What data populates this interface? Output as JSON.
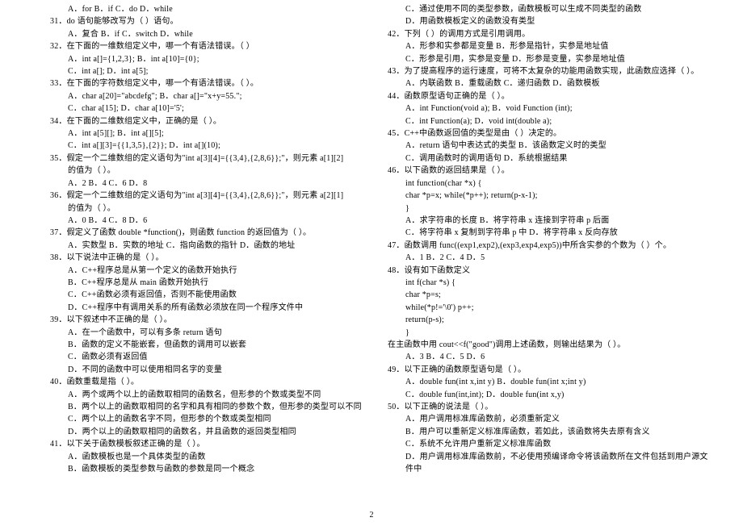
{
  "pageNumber": "2",
  "left": [
    {
      "cls": "indent1",
      "t": "A．for     B．if     C．do     D．while"
    },
    {
      "cls": "",
      "t": "31．do 语句能够改写为（     ）语句。"
    },
    {
      "cls": "indent1",
      "t": "A．复合     B．if     C．switch     D．while"
    },
    {
      "cls": "",
      "t": "32．在下面的一维数组定义中，哪一个有语法错误。（     ）"
    },
    {
      "cls": "indent1",
      "t": "A．int a[]={1,2,3};        B．int a[10]={0};"
    },
    {
      "cls": "indent1",
      "t": "C．int a[];               D．int a[5];"
    },
    {
      "cls": "",
      "t": "33．在下面的字符数组定义中，哪一个有语法错误。（     ）。"
    },
    {
      "cls": "indent1",
      "t": "A．char a[20]=\"abcdefg\";     B．char a[]=\"x+y=55.\";"
    },
    {
      "cls": "indent1",
      "t": "C．char a[15];              D．char a[10]='5';"
    },
    {
      "cls": "",
      "t": "34．在下面的二维数组定义中，正确的是（     ）。"
    },
    {
      "cls": "indent1",
      "t": "A．int a[5][];              B．int a[][5];"
    },
    {
      "cls": "indent1",
      "t": "C．int a[][3]={{1,3,5},{2}};  D．int a[](10);"
    },
    {
      "cls": "",
      "t": "35．假定一个二维数组的定义语句为\"int a[3][4]={{3,4},{2,8,6}};\"，则元素 a[1][2]"
    },
    {
      "cls": "indent1",
      "t": "的值为（     ）。"
    },
    {
      "cls": "indent1",
      "t": "A．2     B．4     C．6     D．8"
    },
    {
      "cls": "",
      "t": "36．假定一个二维数组的定义语句为\"int a[3][4]={{3,4},{2,8,6}};\"，则元素 a[2][1]"
    },
    {
      "cls": "indent1",
      "t": "的值为（     ）。"
    },
    {
      "cls": "indent1",
      "t": "A．0     B．4     C．8     D．6"
    },
    {
      "cls": "",
      "t": "37．假定义了函数 double *function()，则函数 function 的返回值为（     ）。"
    },
    {
      "cls": "indent1",
      "t": "A．实数型     B．实数的地址     C．指向函数的指针     D．函数的地址"
    },
    {
      "cls": "",
      "t": "38．以下说法中正确的是（     ）。"
    },
    {
      "cls": "indent1",
      "t": "A．C++程序总是从第一个定义的函数开始执行"
    },
    {
      "cls": "indent1",
      "t": "B．C++程序总是从 main 函数开始执行"
    },
    {
      "cls": "indent1",
      "t": "C．C++函数必须有返回值，否则不能使用函数"
    },
    {
      "cls": "indent1",
      "t": "D．C++程序中有调用关系的所有函数必须放在同一个程序文件中"
    },
    {
      "cls": "",
      "t": "39．以下叙述中不正确的是（     ）。"
    },
    {
      "cls": "indent1",
      "t": "A．在一个函数中，可以有多条 return 语句"
    },
    {
      "cls": "indent1",
      "t": "B．函数的定义不能嵌套，但函数的调用可以嵌套"
    },
    {
      "cls": "indent1",
      "t": "C．函数必须有返回值"
    },
    {
      "cls": "indent1",
      "t": "D．不同的函数中可以使用相同名字的变量"
    },
    {
      "cls": "",
      "t": "40．函数重载是指（     ）。"
    },
    {
      "cls": "indent1",
      "t": "A．两个或两个以上的函数取相同的函数名，但形参的个数或类型不同"
    },
    {
      "cls": "indent1",
      "t": "B．两个以上的函数取相同的名字和具有相同的参数个数，但形参的类型可以不同"
    },
    {
      "cls": "indent1",
      "t": "C．两个以上的函数名字不同，但形参的个数或类型相同"
    },
    {
      "cls": "indent1",
      "t": "D．两个以上的函数取相同的函数名，并且函数的返回类型相同"
    },
    {
      "cls": "",
      "t": "41．以下关于函数模板叙述正确的是（     ）。"
    },
    {
      "cls": "indent1",
      "t": "A．函数模板也是一个具体类型的函数"
    },
    {
      "cls": "indent1",
      "t": "B．函数模板的类型参数与函数的参数是同一个概念"
    }
  ],
  "right": [
    {
      "cls": "indent1",
      "t": "C．通过使用不同的类型参数，函数模板可以生成不同类型的函数"
    },
    {
      "cls": "indent1",
      "t": "D．用函数模板定义的函数没有类型"
    },
    {
      "cls": "",
      "t": "42．下列（     ）的调用方式是引用调用。"
    },
    {
      "cls": "indent1",
      "t": "A．形参和实参都是变量          B．形参是指针，实参是地址值"
    },
    {
      "cls": "indent1",
      "t": "C．形参是引用，实参是变量       D．形参是变量，实参是地址值"
    },
    {
      "cls": "",
      "t": "43．为了提高程序的运行速度，可将不太复杂的功能用函数实现，此函数应选择（   ）。"
    },
    {
      "cls": "indent1",
      "t": "A．内联函数     B．重载函数     C．递归函数     D．函数模板"
    },
    {
      "cls": "",
      "t": "44．函数原型语句正确的是（     ）。"
    },
    {
      "cls": "indent1",
      "t": "A．int Function(void a);        B．void Function (int);"
    },
    {
      "cls": "indent1",
      "t": "C．int Function(a);            D．void int(double a);"
    },
    {
      "cls": "",
      "t": "45．C++中函数返回值的类型是由（     ）决定的。"
    },
    {
      "cls": "indent1",
      "t": "A．return 语句中表达式的类型     B．该函数定义时的类型"
    },
    {
      "cls": "indent1",
      "t": "C．调用函数时的调用语句          D．系统根据结果"
    },
    {
      "cls": "",
      "t": "46．以下函数的返回结果是（     ）。"
    },
    {
      "cls": "indent1",
      "t": "int function(char *x) {"
    },
    {
      "cls": "indent1",
      "t": "    char *p=x; while(*p++); return(p-x-1);"
    },
    {
      "cls": "indent1",
      "t": "}"
    },
    {
      "cls": "indent1",
      "t": "A．求字符串的长度               B．将字符串 x 连接到字符串 p 后面"
    },
    {
      "cls": "indent1",
      "t": "C．将字符串 x 复制到字符串 p 中   D．将字符串 x 反向存放"
    },
    {
      "cls": "",
      "t": "47．函数调用 func((exp1,exp2),(exp3,exp4,exp5))中所含实参的个数为（   ）个。"
    },
    {
      "cls": "indent1",
      "t": "A．1     B．2     C．4     D．5"
    },
    {
      "cls": "",
      "t": "48．设有如下函数定义"
    },
    {
      "cls": "indent1",
      "t": "int f(char *s) {"
    },
    {
      "cls": "indent1",
      "t": "       char *p=s;"
    },
    {
      "cls": "indent1",
      "t": "       while(*p!='\\0') p++;"
    },
    {
      "cls": "indent1",
      "t": "       return(p-s);"
    },
    {
      "cls": "indent1",
      "t": "   }"
    },
    {
      "cls": "",
      "t": "在主函数中用 cout<<f(\"good\")调用上述函数，则输出结果为（     ）。"
    },
    {
      "cls": "indent1",
      "t": "A．3     B．4     C．5     D．6"
    },
    {
      "cls": "",
      "t": "49．以下正确的函数原型语句是（     ）。"
    },
    {
      "cls": "indent1",
      "t": "A．double fun(int x,int y)        B．double fun(int x;int y)"
    },
    {
      "cls": "indent1",
      "t": "C．double fun(int,int);           D．double fun(int x,y)"
    },
    {
      "cls": "",
      "t": "50．以下正确的说法是（     ）。"
    },
    {
      "cls": "indent1",
      "t": "A．用户调用标准库函数前，必须重新定义"
    },
    {
      "cls": "indent1",
      "t": "B．用户可以重新定义标准库函数，若如此，该函数将失去原有含义"
    },
    {
      "cls": "indent1",
      "t": "C．系统不允许用户重新定义标准库函数"
    },
    {
      "cls": "indent1",
      "t": "D．用户调用标准库函数前，不必使用预编译命令将该函数所在文件包括到用户源文"
    },
    {
      "cls": "indent1",
      "t": "   件中"
    }
  ]
}
